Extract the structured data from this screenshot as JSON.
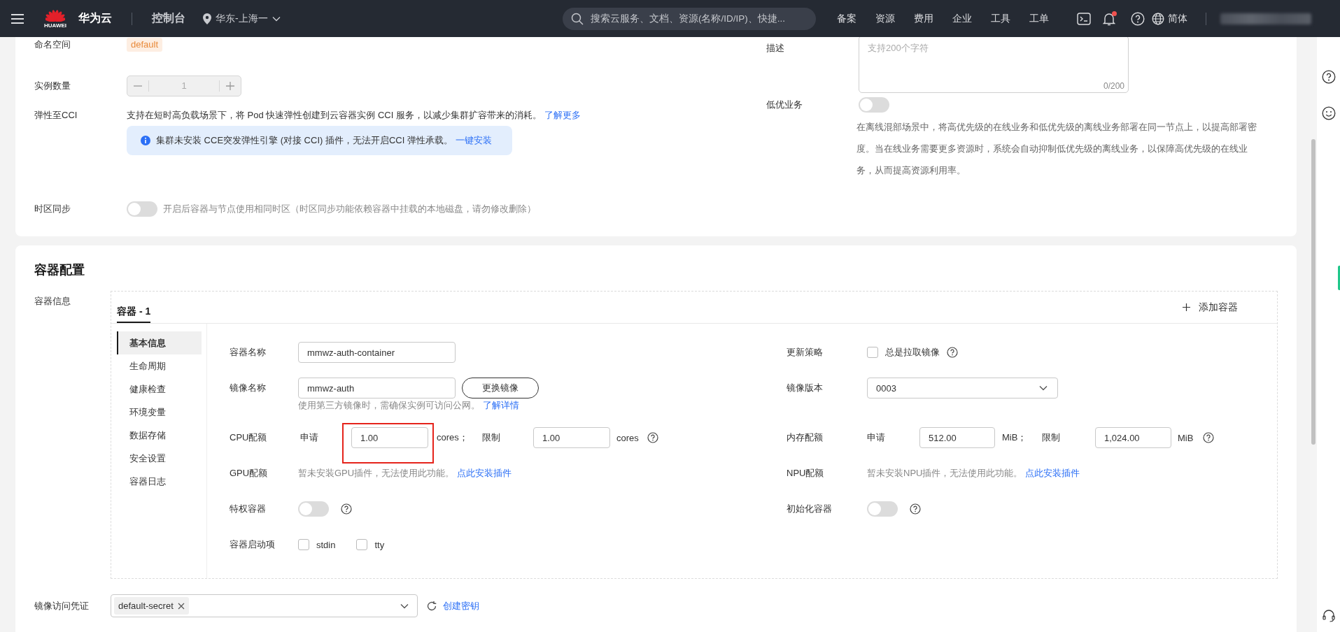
{
  "header": {
    "brand_mark": "HUAWEI",
    "brand": "华为云",
    "console": "控制台",
    "region": "华东-上海一",
    "search": {
      "placeholder": "搜索云服务、文档、资源(名称/ID/IP)、快捷..."
    },
    "nav": [
      "备案",
      "资源",
      "费用",
      "企业",
      "工具",
      "工单"
    ],
    "has_notification": true,
    "language": "简体"
  },
  "basic_settings": {
    "namespace": {
      "label": "命名空间",
      "tag": "default"
    },
    "instance_count": {
      "label": "实例数量",
      "value": "1",
      "disabled": true
    },
    "cci_burst": {
      "label": "弹性至CCI",
      "text": "支持在短时高负载场景下，将 Pod 快速弹性创建到云容器实例 CCI 服务，以减少集群扩容带来的消耗。",
      "link": "了解更多",
      "notice": "集群未安装 CCE突发弹性引擎 (对接 CCI) 插件，无法开启CCI 弹性承载。",
      "notice_link": "一键安装"
    },
    "timezone_sync": {
      "label": "时区同步",
      "on": false,
      "text": "开启后容器与节点使用相同时区（时区同步功能依赖容器中挂载的本地磁盘，请勿修改删除）"
    },
    "description": {
      "label": "描述",
      "placeholder": "支持200个字符",
      "counter": "0/200"
    },
    "low_priority": {
      "label": "低优业务",
      "on": false,
      "text": "在离线混部场景中，将高优先级的在线业务和低优先级的离线业务部署在同一节点上，以提高部署密度。当在线业务需要更多资源时，系统会自动抑制低优先级的离线业务，以保障高优先级的在线业务，从而提高资源利用率。"
    }
  },
  "container_config": {
    "title": "容器配置",
    "info_label": "容器信息",
    "tabs": [
      {
        "label": "容器 - 1",
        "selected": true
      }
    ],
    "add_container": "添加容器",
    "sections": [
      {
        "label": "基本信息",
        "selected": true
      },
      {
        "label": "生命周期",
        "selected": false
      },
      {
        "label": "健康检查",
        "selected": false
      },
      {
        "label": "环境变量",
        "selected": false
      },
      {
        "label": "数据存储",
        "selected": false
      },
      {
        "label": "安全设置",
        "selected": false
      },
      {
        "label": "容器日志",
        "selected": false
      }
    ],
    "name": {
      "label": "容器名称",
      "value": "mmwz-auth-container"
    },
    "image": {
      "label": "镜像名称",
      "value": "mmwz-auth",
      "button": "更换镜像",
      "hint": "使用第三方镜像时，需确保实例可访问公网。",
      "hint_link": "了解详情"
    },
    "cpu": {
      "label": "CPU配额",
      "request_label": "申请",
      "request": "1.00",
      "request_unit": "cores；",
      "request_highlighted": true,
      "limit_label": "限制",
      "limit": "1.00",
      "limit_unit": "cores"
    },
    "gpu": {
      "label": "GPU配额",
      "text": "暂未安装GPU插件，无法使用此功能。",
      "link": "点此安装插件"
    },
    "privileged": {
      "label": "特权容器",
      "on": false
    },
    "startup": {
      "label": "容器启动项",
      "options": [
        {
          "label": "stdin",
          "checked": false
        },
        {
          "label": "tty",
          "checked": false
        }
      ]
    },
    "update_policy": {
      "label": "更新策略",
      "option": {
        "label": "总是拉取镜像",
        "checked": false
      }
    },
    "image_version": {
      "label": "镜像版本",
      "value": "0003"
    },
    "memory": {
      "label": "内存配额",
      "request_label": "申请",
      "request": "512.00",
      "request_unit": "MiB；",
      "limit_label": "限制",
      "limit": "1,024.00",
      "limit_unit": "MiB"
    },
    "npu": {
      "label": "NPU配额",
      "text": "暂未安装NPU插件，无法使用此功能。",
      "link": "点此安装插件"
    },
    "init_container": {
      "label": "初始化容器",
      "on": false
    },
    "pull_secret": {
      "label": "镜像访问凭证",
      "tags": [
        "default-secret"
      ],
      "link": "创建密钥"
    }
  }
}
